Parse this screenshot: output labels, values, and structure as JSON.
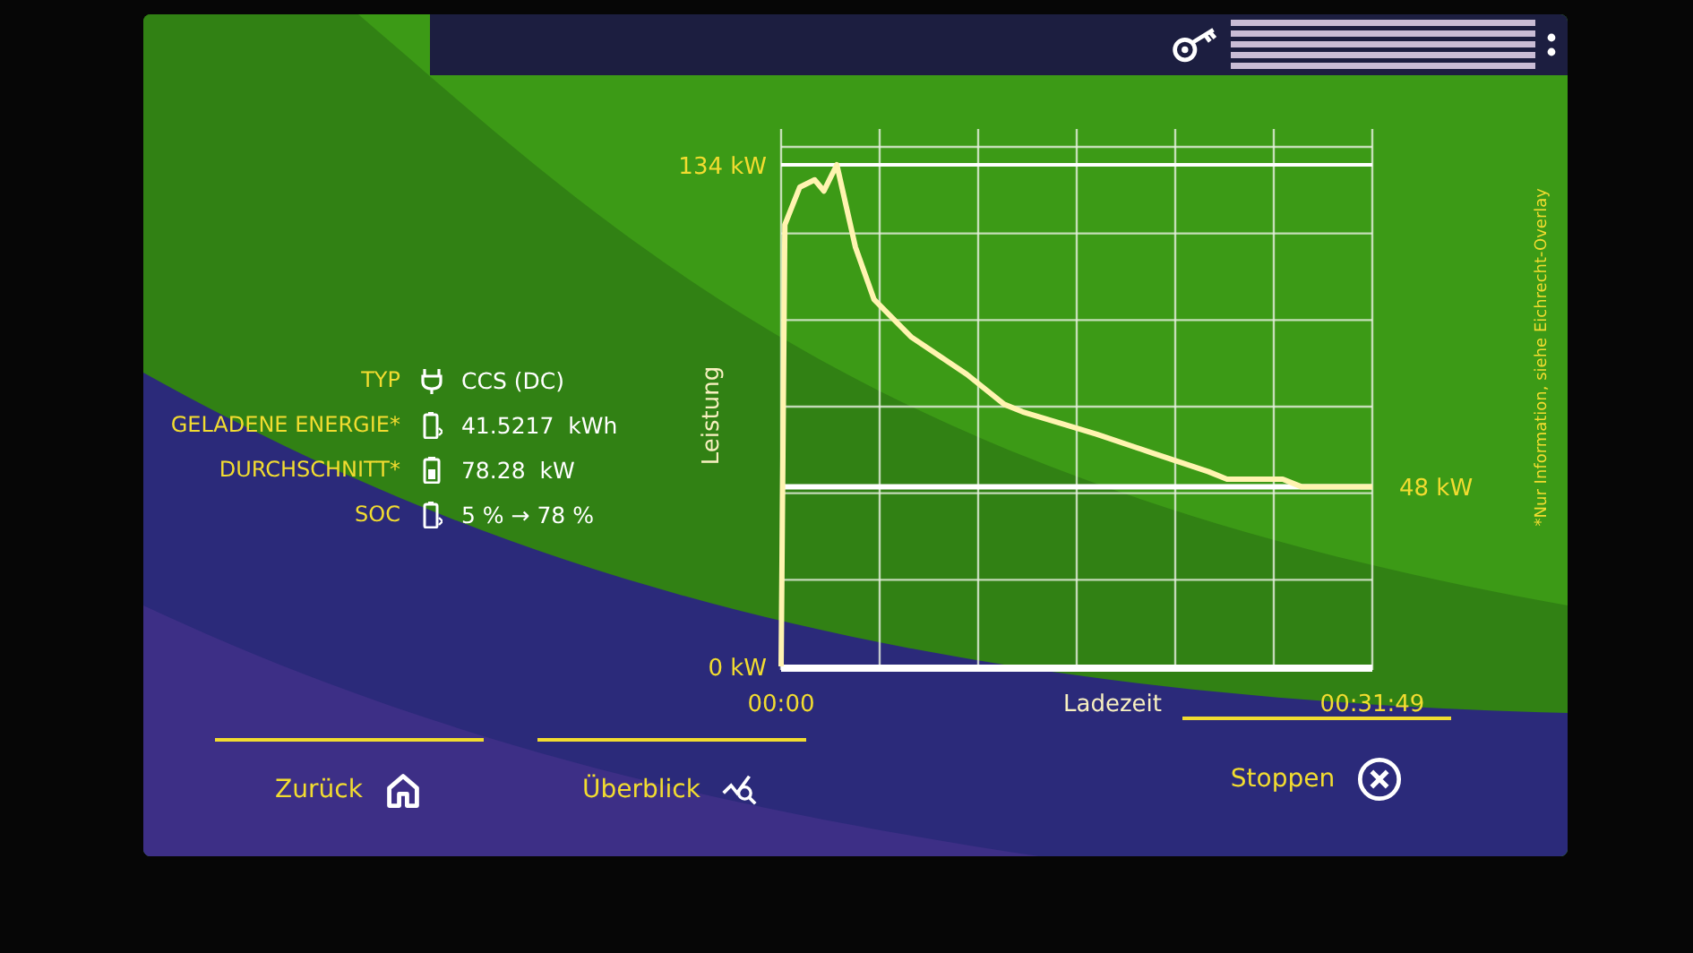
{
  "info": [
    {
      "label": "TYP",
      "value": "CCS (DC)"
    },
    {
      "label": "GELADENE ENERGIE*",
      "value": "41.5217  kWh"
    },
    {
      "label": "DURCHSCHNITT*",
      "value": "78.28  kW"
    },
    {
      "label": "SOC",
      "value": "5 % → 78 %"
    }
  ],
  "chart": {
    "chart_data": {
      "type": "line",
      "ylabel": "Leistung",
      "xlabel": "Ladezeit",
      "xlim": [
        0,
        1909
      ],
      "ylim": [
        0,
        134
      ],
      "xticks": [
        {
          "value": 0,
          "label": "00:00"
        },
        {
          "value": 1909,
          "label": "00:31:49"
        }
      ],
      "yticks": [
        {
          "value": 0,
          "label": "0 kW"
        },
        {
          "value": 134,
          "label": "134 kW"
        }
      ],
      "annotations": [
        {
          "x": 1909,
          "y": 48,
          "text": "48 kW"
        }
      ],
      "x": [
        0,
        12,
        60,
        108,
        138,
        180,
        240,
        300,
        420,
        600,
        720,
        780,
        900,
        1020,
        1200,
        1380,
        1440,
        1620,
        1680,
        1909
      ],
      "series": [
        {
          "color": "#ffffff",
          "values": [
            48,
            48,
            48,
            48,
            48,
            48,
            48,
            48,
            48,
            48,
            48,
            48,
            48,
            48,
            48,
            48,
            48,
            48,
            48,
            48
          ]
        },
        {
          "color": "#fff4b0",
          "values": [
            0,
            118,
            128,
            130,
            127,
            134,
            112,
            98,
            88,
            78,
            70,
            68,
            65,
            62,
            57,
            52,
            50,
            50,
            48,
            48
          ]
        }
      ]
    }
  },
  "note": "*Nur Information, siehe Eichrecht-Overlay",
  "buttons": [
    {
      "label": "Zurück"
    },
    {
      "label": "Überblick"
    },
    {
      "label": "Stoppen"
    }
  ]
}
